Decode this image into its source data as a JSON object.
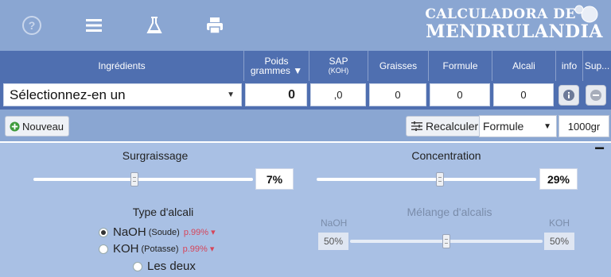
{
  "toolbar_icons": [
    "help-icon",
    "menu-icon",
    "flask-icon",
    "print-icon"
  ],
  "logo": {
    "line1": "CALCULADORA DE",
    "line2": "MENDRULANDIA"
  },
  "table": {
    "headers": {
      "ingredients": "Ingrédients",
      "weight": "Poids",
      "weight_unit": "grammes ▼",
      "sap": "SAP",
      "sap_unit": "(KOH)",
      "fats": "Graisses",
      "formula": "Formule",
      "alkali": "Alcali",
      "info": "info",
      "delete": "Sup..."
    },
    "row": {
      "ingredient_select": "Sélectionnez-en un",
      "weight": "0",
      "sap": ",0",
      "fats": "0",
      "formula": "0",
      "alkali": "0"
    }
  },
  "actions": {
    "new_label": "Nouveau",
    "recalc_label": "Recalculer",
    "mode_select": "Formule",
    "total_weight": "1000gr"
  },
  "settings": {
    "collapse": "−",
    "superfat_label": "Surgraissage",
    "superfat_value": "7%",
    "superfat_fraction": 0.46,
    "concentration_label": "Concentration",
    "concentration_value": "29%",
    "concentration_fraction": 0.56,
    "alkali_type_label": "Type d'alcali",
    "naoh_label": "NaOH",
    "naoh_sub": "(Soude)",
    "naoh_purity": "p.99% ▾",
    "koh_label": "KOH",
    "koh_sub": "(Potasse)",
    "koh_purity": "p.99% ▾",
    "both_label": "Les deux",
    "mix_label": "Mélange d'alcalis",
    "mix_naoh": "NaOH",
    "mix_koh": "KOH",
    "mix_naoh_value": "50%",
    "mix_koh_value": "50%",
    "mix_fraction": 0.5
  }
}
